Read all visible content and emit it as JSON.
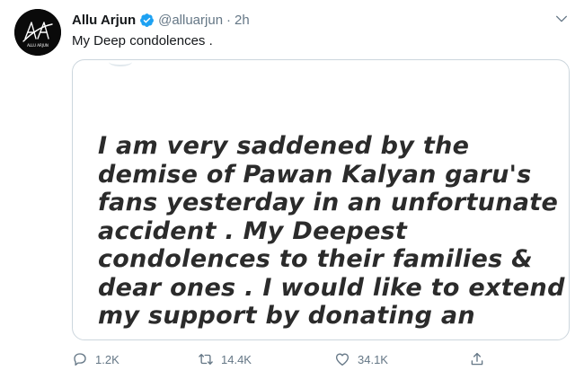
{
  "tweet": {
    "author": {
      "display_name": "Allu Arjun",
      "handle": "@alluarjun",
      "verified": true,
      "avatar_icon": "allu-arjun-logo",
      "avatar_text": "ALLU ARJUN"
    },
    "separator": "·",
    "time": "2h",
    "text": "My Deep condolences .",
    "media": {
      "lines": [
        "I am very saddened by the",
        "demise of Pawan Kalyan garu's",
        "fans yesterday in an unfortunate",
        "accident . My Deepest",
        "condolences to their families &",
        "dear ones . I would like to extend",
        "my support by donating an"
      ]
    },
    "actions": {
      "replies": "1.2K",
      "retweets": "14.4K",
      "likes": "34.1K"
    }
  },
  "colors": {
    "verified": "#1da1f2",
    "secondary_text": "#657786",
    "border": "#ccd6dd"
  }
}
